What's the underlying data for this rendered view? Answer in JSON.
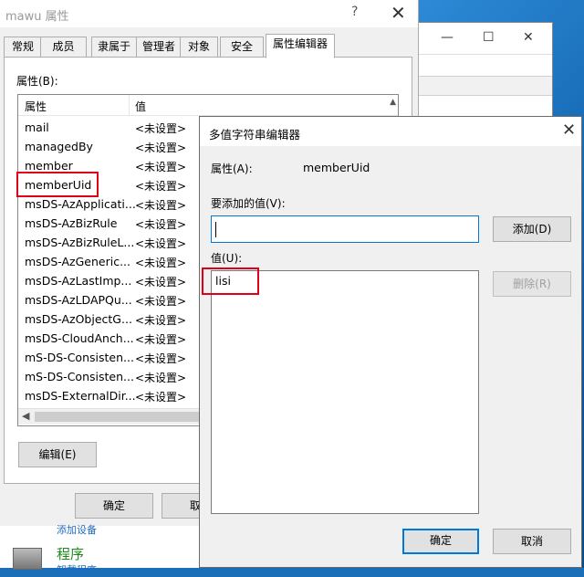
{
  "properties_dialog": {
    "title": "mawu 属性",
    "help_glyph": "?",
    "close_glyph": "✕",
    "tabs": [
      {
        "label": "常规"
      },
      {
        "label": "成员"
      },
      {
        "label": "隶属于"
      },
      {
        "label": "管理者"
      },
      {
        "label": "对象"
      },
      {
        "label": "安全"
      },
      {
        "label": "属性编辑器"
      }
    ],
    "active_tab": "属性编辑器",
    "attributes_label": "属性(B):",
    "columns": {
      "attribute": "属性",
      "value": "值"
    },
    "rows": [
      {
        "name": "mail",
        "value": "<未设置>"
      },
      {
        "name": "managedBy",
        "value": "<未设置>"
      },
      {
        "name": "member",
        "value": "<未设置>"
      },
      {
        "name": "memberUid",
        "value": "<未设置>"
      },
      {
        "name": "msDS-AzApplicati...",
        "value": "<未设置>"
      },
      {
        "name": "msDS-AzBizRule",
        "value": "<未设置>"
      },
      {
        "name": "msDS-AzBizRuleL...",
        "value": "<未设置>"
      },
      {
        "name": "msDS-AzGeneric...",
        "value": "<未设置>"
      },
      {
        "name": "msDS-AzLastImp...",
        "value": "<未设置>"
      },
      {
        "name": "msDS-AzLDAPQu...",
        "value": "<未设置>"
      },
      {
        "name": "msDS-AzObjectG...",
        "value": "<未设置>"
      },
      {
        "name": "msDS-CloudAnch...",
        "value": "<未设置>"
      },
      {
        "name": "mS-DS-Consisten...",
        "value": "<未设置>"
      },
      {
        "name": "mS-DS-Consisten...",
        "value": "<未设置>"
      },
      {
        "name": "msDS-ExternalDir...",
        "value": "<未设置>"
      }
    ],
    "edit_button": "编辑(E)",
    "ok_button": "确定",
    "cancel_partial": "取"
  },
  "control_panel": {
    "link_text": "添加设备",
    "programs_label": "程序",
    "uninstall_text": "卸载程序"
  },
  "editor_dialog": {
    "title": "多值字符串编辑器",
    "close_glyph": "✕",
    "attribute_label": "属性(A):",
    "attribute_value": "memberUid",
    "add_value_label": "要添加的值(V):",
    "add_value_input": "",
    "add_button": "添加(D)",
    "values_label": "值(U):",
    "values": [
      "lisi"
    ],
    "remove_button": "删除(R)",
    "ok_button": "确定",
    "cancel_button": "取消"
  },
  "colors": {
    "highlight_box": "#e0001a",
    "focus_blue": "#0078d7"
  }
}
